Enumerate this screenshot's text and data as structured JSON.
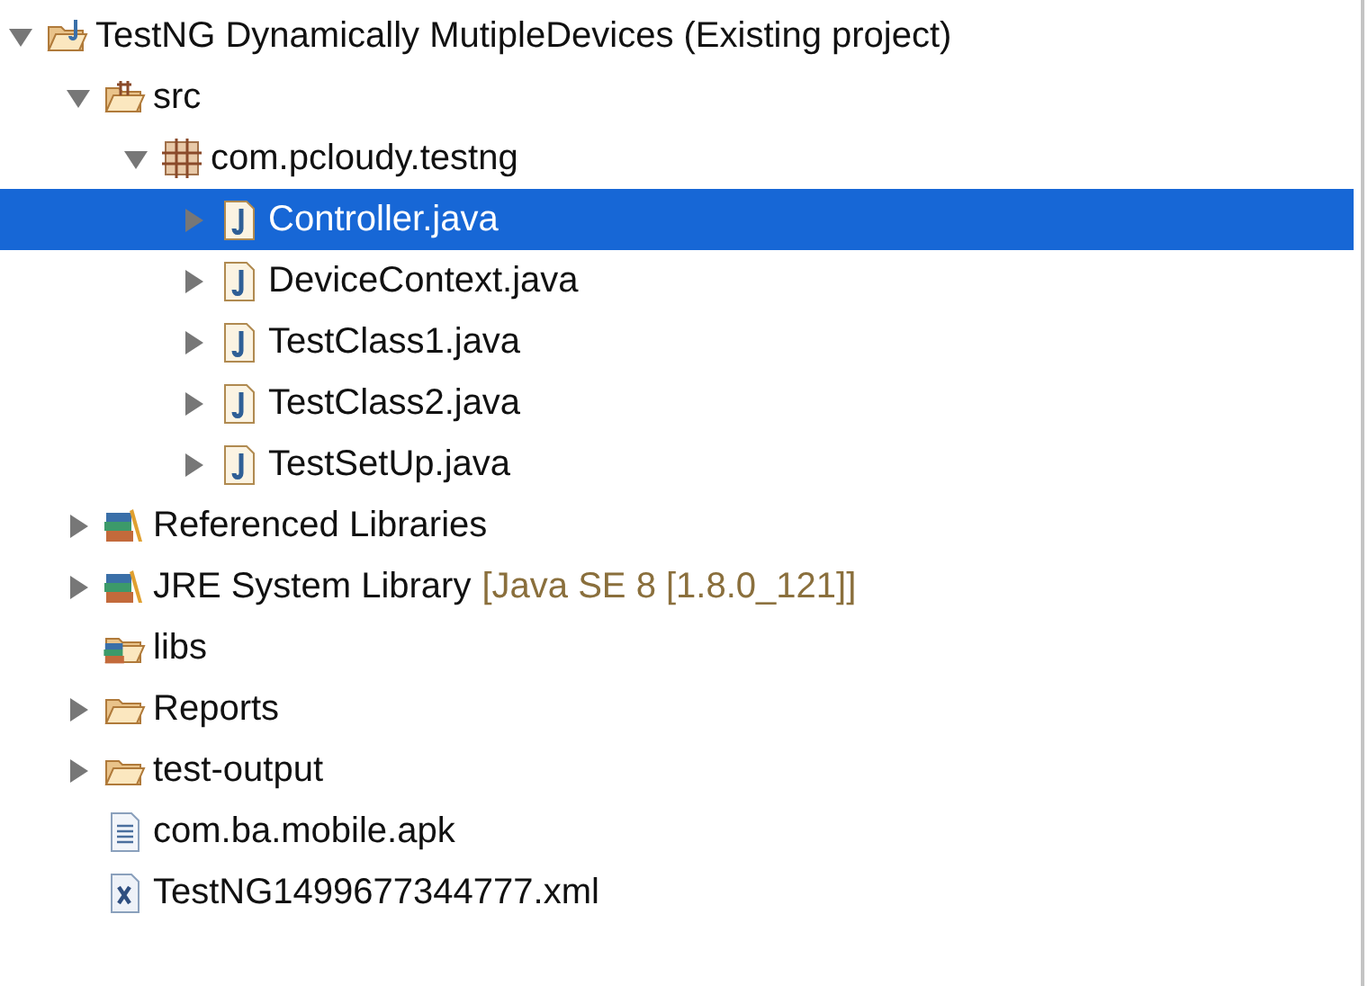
{
  "tree": [
    {
      "label": "TestNG Dynamically MutipleDevices (Existing project)",
      "kind": "project",
      "expanded": true,
      "selected": false,
      "children": [
        {
          "label": "src",
          "kind": "source-folder",
          "expanded": true,
          "selected": false,
          "children": [
            {
              "label": "com.pcloudy.testng",
              "kind": "package",
              "expanded": true,
              "selected": false,
              "children": [
                {
                  "label": "Controller.java",
                  "kind": "java",
                  "expanded": false,
                  "selected": true
                },
                {
                  "label": "DeviceContext.java",
                  "kind": "java",
                  "expanded": false,
                  "selected": false
                },
                {
                  "label": "TestClass1.java",
                  "kind": "java",
                  "expanded": false,
                  "selected": false
                },
                {
                  "label": "TestClass2.java",
                  "kind": "java",
                  "expanded": false,
                  "selected": false
                },
                {
                  "label": "TestSetUp.java",
                  "kind": "java",
                  "expanded": false,
                  "selected": false
                }
              ]
            }
          ]
        },
        {
          "label": "Referenced Libraries",
          "kind": "library",
          "expanded": false,
          "selected": false
        },
        {
          "label": "JRE System Library",
          "decoration": "[Java SE 8 [1.8.0_121]]",
          "kind": "library",
          "expanded": false,
          "selected": false
        },
        {
          "label": "libs",
          "kind": "lib-folder",
          "selected": false
        },
        {
          "label": "Reports",
          "kind": "folder",
          "expanded": false,
          "selected": false
        },
        {
          "label": "test-output",
          "kind": "folder",
          "expanded": false,
          "selected": false
        },
        {
          "label": "com.ba.mobile.apk",
          "kind": "text-file",
          "selected": false
        },
        {
          "label": "TestNG1499677344777.xml",
          "kind": "xml-file",
          "selected": false
        }
      ]
    }
  ]
}
